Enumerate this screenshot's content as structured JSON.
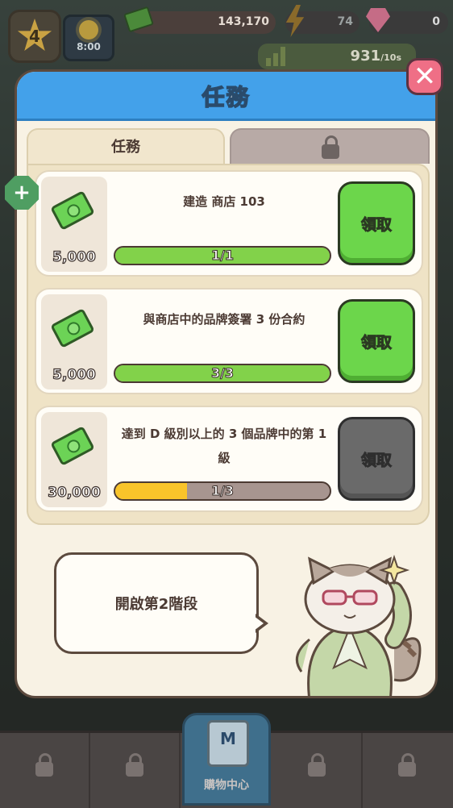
{
  "hud": {
    "level": "4",
    "clock": "8:00",
    "money": "143,170",
    "energy": "74",
    "gems": "0",
    "income": "931",
    "income_unit": "/10s"
  },
  "panel": {
    "title": "任務",
    "tab_active": "任務"
  },
  "missions": [
    {
      "text": "建造 商店 103",
      "reward": "5,000",
      "progress_label": "1/1",
      "progress": 1.0,
      "claim": "領取",
      "claimable": true
    },
    {
      "text": "與商店中的品牌簽署 3 份合約",
      "reward": "5,000",
      "progress_label": "3/3",
      "progress": 1.0,
      "claim": "領取",
      "claimable": true
    },
    {
      "text": "達到 D 級別以上的 3 個品牌中的第 1 級",
      "reward": "30,000",
      "progress_label": "1/3",
      "progress": 0.333,
      "claim": "領取",
      "claimable": false
    }
  ],
  "speech": "開啟第2階段",
  "nav": {
    "shop_label": "購物中心"
  },
  "colors": {
    "header_blue": "#43a1ea",
    "claim_green": "#6cd64b",
    "claim_gray": "#6a6a6a",
    "progress_green": "#82d24a",
    "progress_yellow": "#f9c42a",
    "close_pink": "#ef6f86"
  }
}
